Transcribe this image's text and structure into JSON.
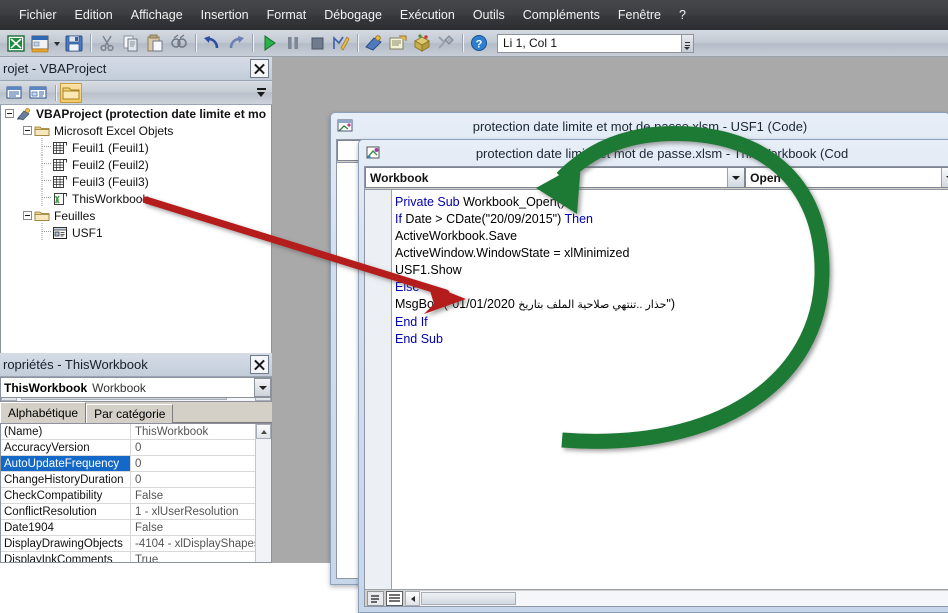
{
  "app": {
    "position_indicator": "Li 1, Col 1"
  },
  "menubar": {
    "items": [
      {
        "label": "Fichier"
      },
      {
        "label": "Edition"
      },
      {
        "label": "Affichage"
      },
      {
        "label": "Insertion"
      },
      {
        "label": "Format"
      },
      {
        "label": "Débogage"
      },
      {
        "label": "Exécution"
      },
      {
        "label": "Outils"
      },
      {
        "label": "Compléments"
      },
      {
        "label": "Fenêtre"
      },
      {
        "label": "?"
      }
    ]
  },
  "toolbar": {
    "buttons": [
      {
        "name": "view-excel-icon"
      },
      {
        "name": "insert-userform-icon"
      },
      {
        "name": "save-icon"
      },
      {
        "name": "cut-icon"
      },
      {
        "name": "copy-icon"
      },
      {
        "name": "paste-icon"
      },
      {
        "name": "find-icon"
      },
      {
        "name": "undo-icon"
      },
      {
        "name": "redo-icon"
      },
      {
        "name": "run-icon"
      },
      {
        "name": "break-icon"
      },
      {
        "name": "reset-icon"
      },
      {
        "name": "design-mode-icon"
      },
      {
        "name": "project-explorer-icon"
      },
      {
        "name": "properties-window-icon"
      },
      {
        "name": "object-browser-icon"
      },
      {
        "name": "toolbox-icon"
      },
      {
        "name": "help-icon"
      }
    ]
  },
  "project_explorer": {
    "title": "rojet - VBAProject",
    "toolbar_buttons": [
      {
        "name": "view-code-icon"
      },
      {
        "name": "view-object-icon"
      },
      {
        "name": "toggle-folders-icon"
      }
    ],
    "tree": [
      {
        "label": "VBAProject (protection date limite et mo",
        "indent": 0,
        "icon": "project-icon",
        "bold": true,
        "expanded": true
      },
      {
        "label": "Microsoft Excel Objets",
        "indent": 1,
        "icon": "folder-icon",
        "bold": false,
        "expanded": true
      },
      {
        "label": "Feuil1 (Feuil1)",
        "indent": 2,
        "icon": "sheet-icon",
        "bold": false,
        "expanded": null
      },
      {
        "label": "Feuil2 (Feuil2)",
        "indent": 2,
        "icon": "sheet-icon",
        "bold": false,
        "expanded": null
      },
      {
        "label": "Feuil3 (Feuil3)",
        "indent": 2,
        "icon": "sheet-icon",
        "bold": false,
        "expanded": null
      },
      {
        "label": "ThisWorkbook",
        "indent": 2,
        "icon": "workbook-icon",
        "bold": false,
        "expanded": null
      },
      {
        "label": "Feuilles",
        "indent": 1,
        "icon": "folder-icon",
        "bold": false,
        "expanded": true
      },
      {
        "label": "USF1",
        "indent": 2,
        "icon": "userform-icon",
        "bold": false,
        "expanded": null
      }
    ]
  },
  "properties": {
    "title": "ropriétés - ThisWorkbook",
    "object_name": "ThisWorkbook",
    "object_type": "Workbook",
    "tabs": [
      {
        "label": "Alphabétique",
        "selected": true
      },
      {
        "label": "Par catégorie",
        "selected": false
      }
    ],
    "rows": [
      {
        "name": "(Name)",
        "value": "ThisWorkbook",
        "selected": false
      },
      {
        "name": "AccuracyVersion",
        "value": "0",
        "selected": false
      },
      {
        "name": "AutoUpdateFrequency",
        "value": "0",
        "selected": true
      },
      {
        "name": "ChangeHistoryDuration",
        "value": "0",
        "selected": false
      },
      {
        "name": "CheckCompatibility",
        "value": "False",
        "selected": false
      },
      {
        "name": "ConflictResolution",
        "value": "1 - xlUserResolution",
        "selected": false
      },
      {
        "name": "Date1904",
        "value": "False",
        "selected": false
      },
      {
        "name": "DisplayDrawingObjects",
        "value": "-4104 - xlDisplayShapes",
        "selected": false
      },
      {
        "name": "DisplayInkComments",
        "value": "True",
        "selected": false
      }
    ]
  },
  "code_window_back": {
    "title": "protection date limite et mot de passe.xlsm - USF1 (Code)"
  },
  "code_window_front": {
    "title": "protection date limite et mot de passe.xlsm - ThisWorkbook (Cod",
    "object_combo": "Workbook",
    "procedure_combo": "Open",
    "code_lines": [
      {
        "segments": [
          {
            "t": "Private Sub ",
            "kw": true
          },
          {
            "t": "Workbook_Open()",
            "kw": false
          }
        ]
      },
      {
        "segments": [
          {
            "t": "If ",
            "kw": true
          },
          {
            "t": "Date > CDate(\"20/09/2015\") ",
            "kw": false
          },
          {
            "t": "Then",
            "kw": true
          }
        ]
      },
      {
        "segments": [
          {
            "t": "ActiveWorkbook.Save",
            "kw": false
          }
        ]
      },
      {
        "segments": [
          {
            "t": "ActiveWindow.WindowState = xlMinimized",
            "kw": false
          }
        ]
      },
      {
        "segments": [
          {
            "t": "USF1.Show",
            "kw": false
          }
        ]
      },
      {
        "segments": [
          {
            "t": "Else",
            "kw": true
          }
        ]
      },
      {
        "segments": [
          {
            "t": "MsgBox (\"01/01/2020 ",
            "kw": false
          },
          {
            "t": "حذار ..تنتهي صلاحية الملف بتاريخ",
            "kw": false,
            "rtl": true
          },
          {
            "t": "\")",
            "kw": false
          }
        ]
      },
      {
        "segments": [
          {
            "t": "End If",
            "kw": true
          }
        ]
      },
      {
        "segments": [
          {
            "t": "End Sub",
            "kw": true
          }
        ]
      }
    ]
  },
  "annotations": {
    "green_arrow_color": "#1f7a34",
    "red_arrow_color": "#b51c1c"
  }
}
